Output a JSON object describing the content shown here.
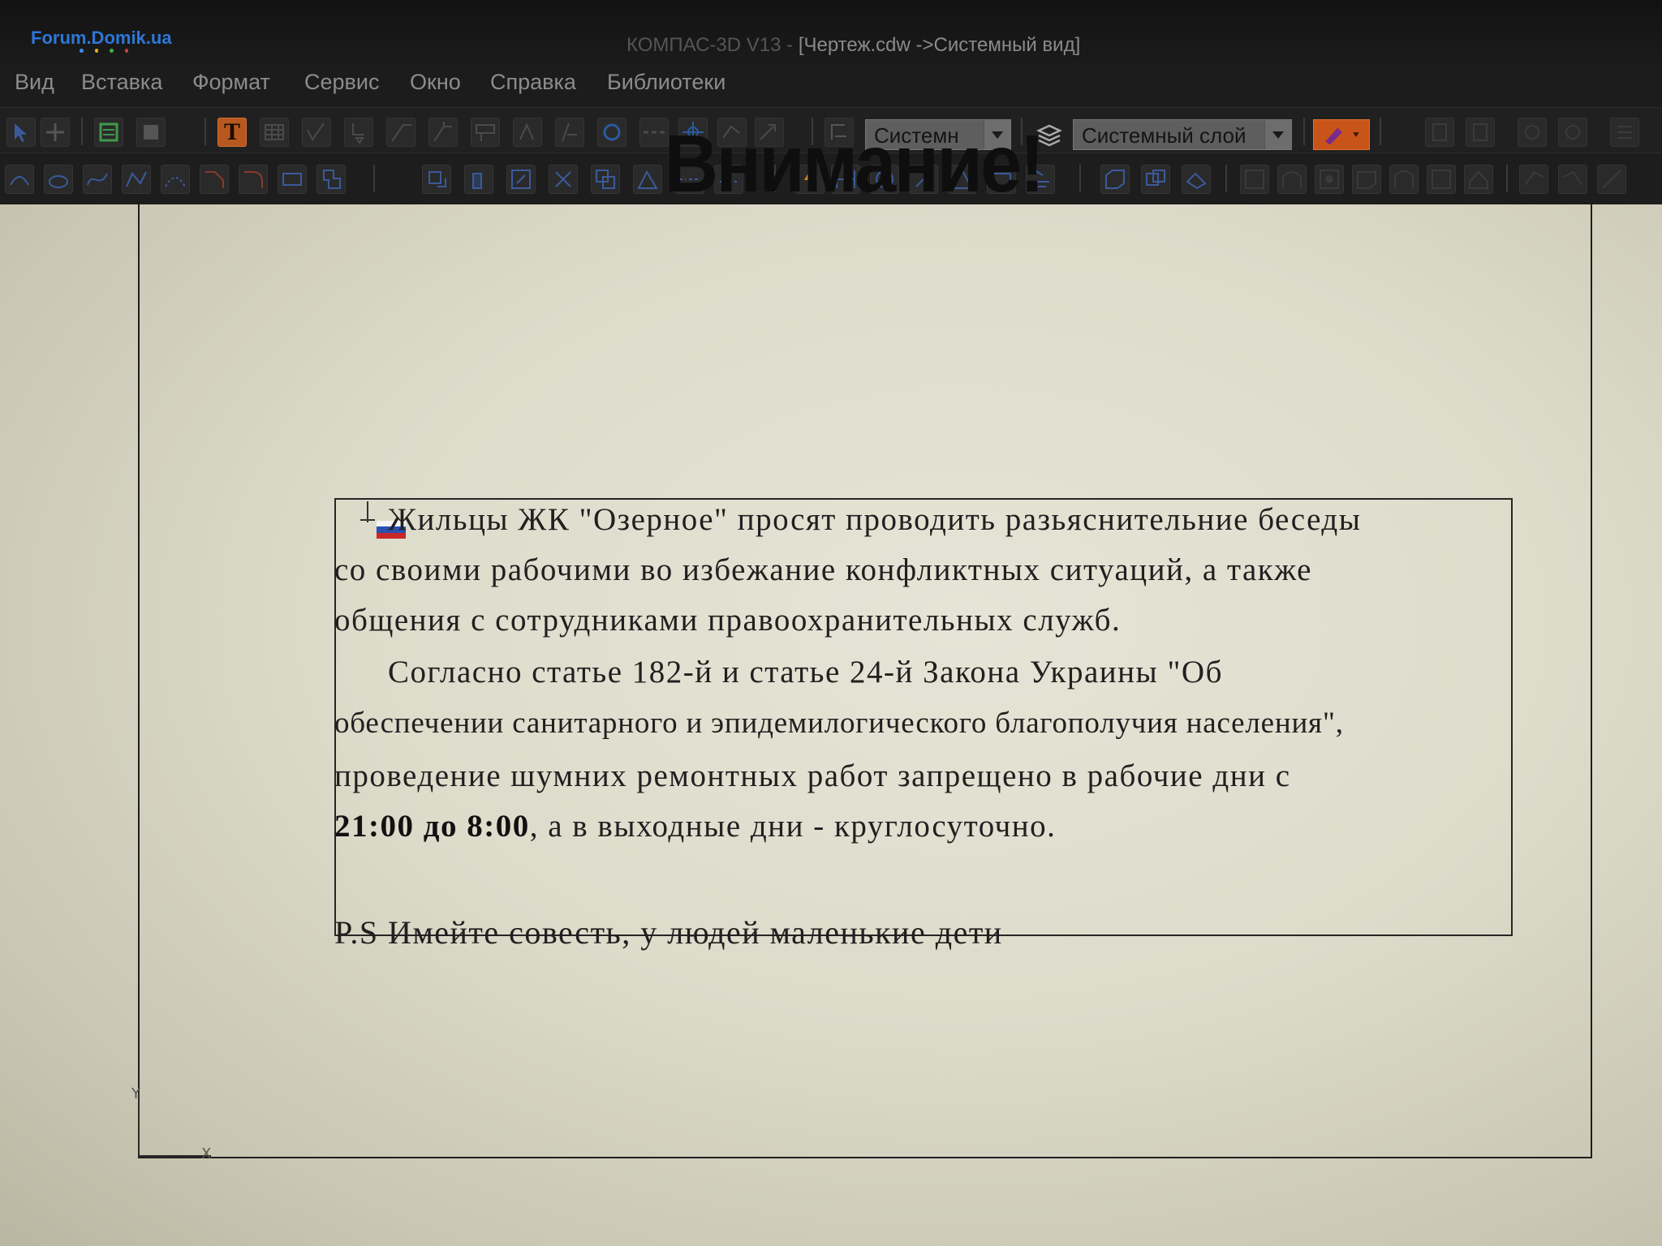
{
  "app": {
    "watermark": "Forum.Domik.ua",
    "title_app": "КОМПАС-3D V13 - ",
    "title_doc": "[Чертеж.cdw ->Системный вид]"
  },
  "menu": [
    {
      "label": "Вид"
    },
    {
      "label": "Вставка"
    },
    {
      "label": "Формат"
    },
    {
      "label": "Сервис"
    },
    {
      "label": "Окно"
    },
    {
      "label": "Справка"
    },
    {
      "label": "Библиотеки"
    }
  ],
  "toolbar": {
    "style_combo": "Системн",
    "layer_combo": "Системный слой",
    "text_tool_glyph": "T"
  },
  "document": {
    "heading": "Внимание!",
    "lines": [
      "Жильцы ЖК \"Озерное\" просят проводить разьяснительние беседы",
      "со своими рабочими во избежание конфликтных ситуаций, а также",
      "общения с сотрудниками правоохранительных служб.",
      "Согласно статье 182-й и статье 24-й Закона Украины \"Об",
      "обеспечении санитарного и эпидемилогического благополучия населения\",",
      "проведение шумних ремонтных работ запрещено в рабочие дни с"
    ],
    "time_range": "21:00 до 8:00",
    "time_rest": ", а в выходные дни - круглосуточно.",
    "ps": "P.S Имейте совесть, у людей маленькие дети"
  },
  "axes": {
    "x": "X",
    "y": "Y"
  },
  "colors": {
    "accent": "#c9541a",
    "watermark": "#2d77d8",
    "paper": "#e2e0d0"
  }
}
